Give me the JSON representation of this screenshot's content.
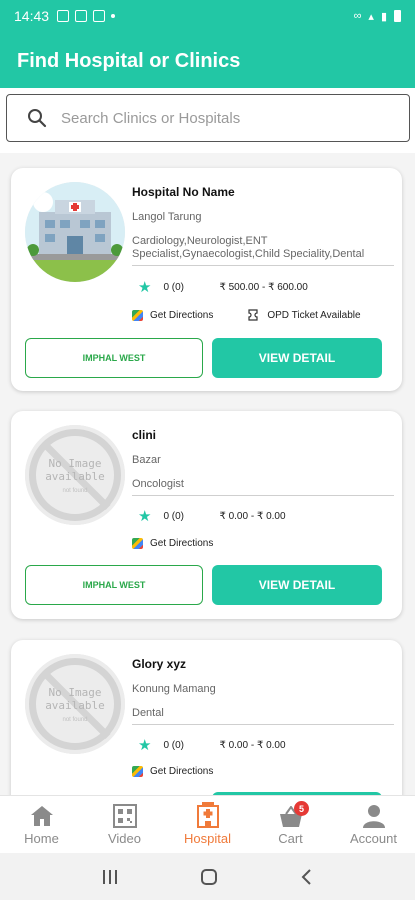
{
  "status_bar": {
    "time": "14:43"
  },
  "header": {
    "title": "Find Hospital or Clinics"
  },
  "search": {
    "placeholder": "Search Clinics or Hospitals",
    "value": ""
  },
  "cards": [
    {
      "name": "Hospital No Name",
      "address": "Langol Tarung",
      "specialities": "Cardiology,Neurologist,ENT Specialist,Gynaecologist,Child Speciality,Dental",
      "rating": "0 (0)",
      "price": "₹ 500.00  - ₹ 600.00",
      "directions_label": "Get Directions",
      "opd_label": "OPD Ticket Available",
      "area_label": "IMPHAL WEST",
      "view_label": "VIEW DETAIL",
      "has_image": true
    },
    {
      "name": "clini",
      "address": "Bazar",
      "specialities": "Oncologist",
      "rating": "0 (0)",
      "price": "₹ 0.00   - ₹ 0.00",
      "directions_label": "Get Directions",
      "area_label": "IMPHAL WEST",
      "view_label": "VIEW DETAIL",
      "has_image": false,
      "no_image_text": "No Image available",
      "no_image_sub": "not found"
    },
    {
      "name": "Glory xyz",
      "address": "Konung Mamang",
      "specialities": "Dental",
      "rating": "0 (0)",
      "price": "₹ 0.00   - ₹ 0.00",
      "directions_label": "Get Directions",
      "has_image": false,
      "no_image_text": "No Image available",
      "no_image_sub": "not found"
    }
  ],
  "bottom_nav": {
    "home": "Home",
    "video": "Video",
    "hospital": "Hospital",
    "cart": "Cart",
    "cart_badge": "5",
    "account": "Account",
    "active": "hospital"
  },
  "colors": {
    "accent": "#22c7a5",
    "active_nav": "#f07a3a",
    "area_border": "#2aa84a",
    "badge": "#e53935"
  }
}
